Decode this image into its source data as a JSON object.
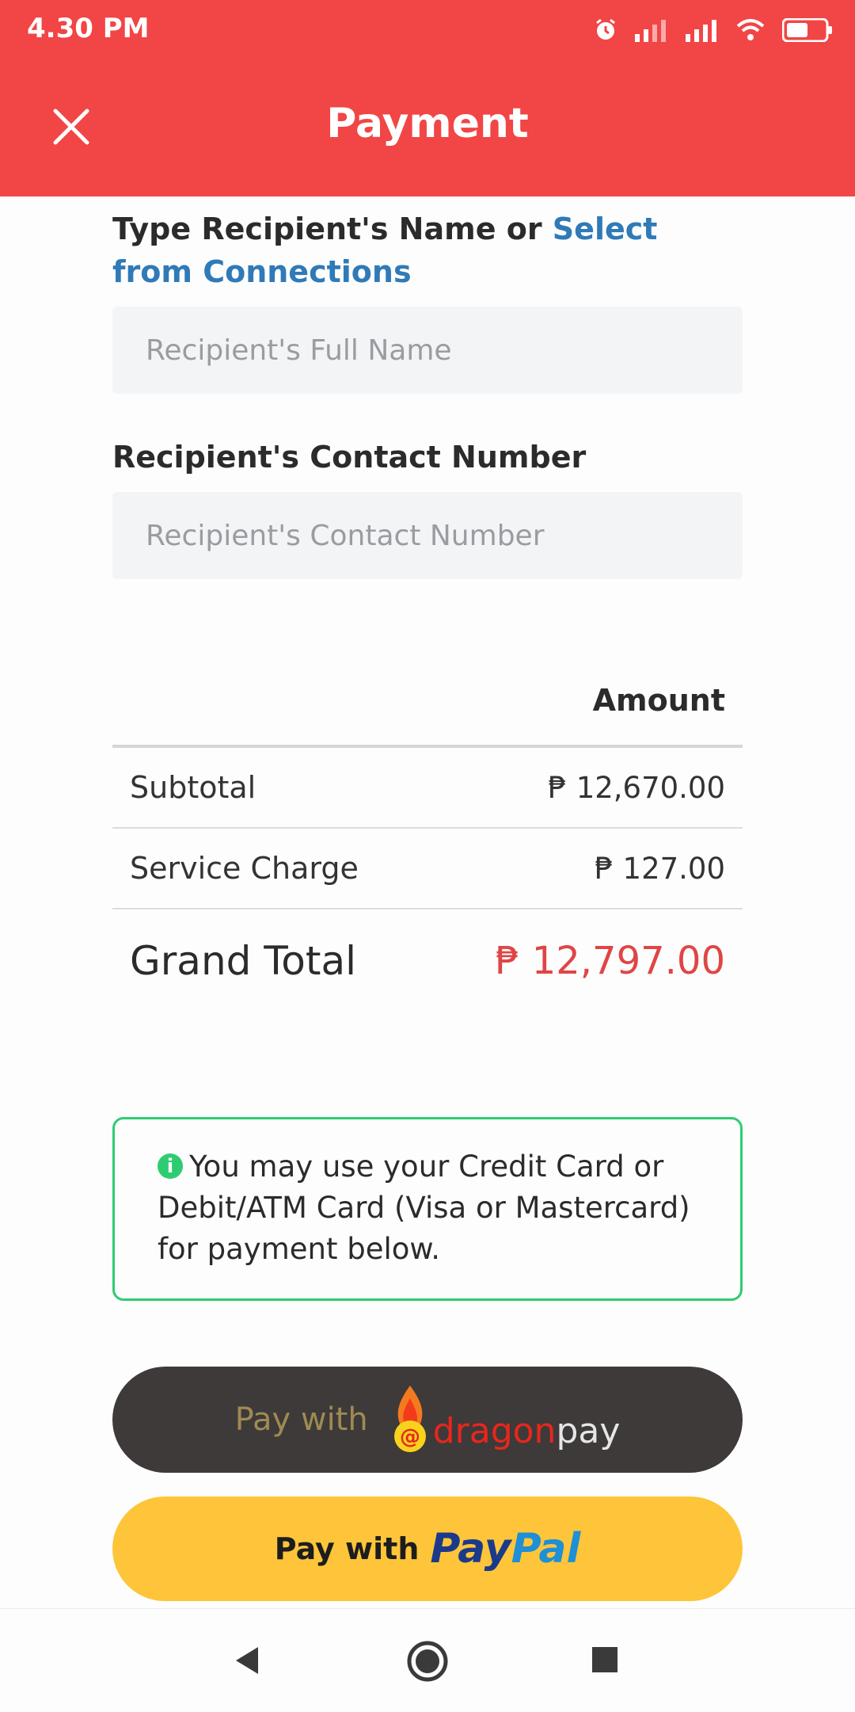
{
  "status_bar": {
    "time": "4.30 PM"
  },
  "header": {
    "title": "Payment"
  },
  "recipient": {
    "name_label": "Type Recipient's Name or ",
    "name_link": "Select from Connections",
    "name_placeholder": "Recipient's Full Name",
    "contact_label": "Recipient's Contact Number",
    "contact_placeholder": "Recipient's Contact Number"
  },
  "summary": {
    "amount_header": "Amount",
    "rows": [
      {
        "label": "Subtotal",
        "value": "₱ 12,670.00"
      },
      {
        "label": "Service Charge",
        "value": "₱ 127.00"
      }
    ],
    "grand_total_label": "Grand Total",
    "grand_total_value": "₱ 12,797.00"
  },
  "notice": {
    "text": "You may use your Credit Card or Debit/ATM Card (Visa or Mastercard) for payment below."
  },
  "payment_buttons": {
    "dragonpay_prefix": "Pay with",
    "dragonpay_brand_1": "dragon",
    "dragonpay_brand_2": "pay",
    "paypal_prefix": "Pay with",
    "paypal_brand_1": "Pay",
    "paypal_brand_2": "Pal"
  },
  "colors": {
    "accent": "#f24545",
    "link": "#2f7ab7",
    "total_red": "#e04545",
    "info_green": "#2ecc71",
    "dragonpay_bg": "#3d3a39",
    "paypal_bg": "#fec53a"
  },
  "icons": [
    "alarm-icon",
    "signal-icon",
    "wifi-icon",
    "battery-icon",
    "close-icon",
    "info-icon",
    "back-icon",
    "home-icon",
    "recents-icon"
  ]
}
